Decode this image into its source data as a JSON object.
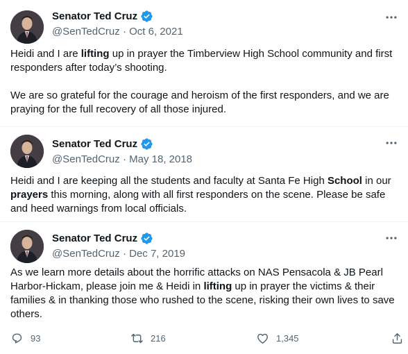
{
  "author": {
    "name": "Senator Ted Cruz",
    "handle": "@SenTedCruz",
    "verified_color": "#1d9bf0"
  },
  "tweets": [
    {
      "date": "Oct 6, 2021",
      "segments": [
        {
          "t": "Heidi and I are "
        },
        {
          "t": "lifting",
          "b": true
        },
        {
          "t": " up in prayer the Timberview High School community and first responders after today’s shooting.\n\nWe are so grateful for the courage and heroism of the first responders, and we are praying for the full recovery of all those injured."
        }
      ]
    },
    {
      "date": "May 18, 2018",
      "segments": [
        {
          "t": "Heidi and I are keeping all the students and faculty at Santa Fe High "
        },
        {
          "t": "School",
          "b": true
        },
        {
          "t": " in our "
        },
        {
          "t": "prayers",
          "b": true
        },
        {
          "t": " this morning, along with all first responders on the scene. Please be safe and heed warnings from local officials."
        }
      ]
    },
    {
      "date": "Dec 7, 2019",
      "segments": [
        {
          "t": "As we learn more details about the horrific attacks on NAS Pensacola & JB Pearl Harbor-Hickam, please join me & Heidi in "
        },
        {
          "t": "lifting",
          "b": true
        },
        {
          "t": " up in prayer the victims & their families & in thanking those who rushed to the scene, risking their own lives to save others."
        }
      ],
      "actions": {
        "replies": "93",
        "retweets": "216",
        "likes": "1,345"
      }
    }
  ],
  "icons": {
    "more": "more-horizontal-icon",
    "reply": "reply-icon",
    "retweet": "retweet-icon",
    "like": "heart-icon",
    "share": "share-icon",
    "verified": "verified-badge-icon"
  }
}
